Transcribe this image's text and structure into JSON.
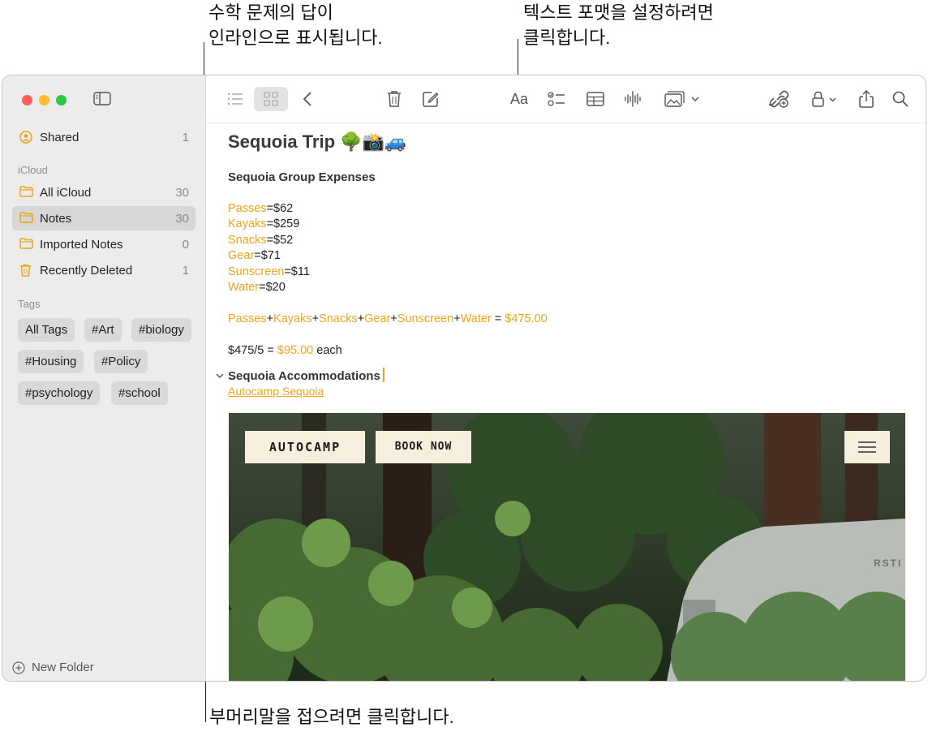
{
  "callouts": {
    "top_left_line1": "수학 문제의 답이",
    "top_left_line2": "인라인으로 표시됩니다.",
    "top_right_line1": "텍스트 포맷을 설정하려면",
    "top_right_line2": "클릭합니다.",
    "bottom": "부머리말을 접으려면 클릭합니다."
  },
  "sidebar": {
    "shared": {
      "label": "Shared",
      "count": "1"
    },
    "icloud_header": "iCloud",
    "folders": [
      {
        "label": "All iCloud",
        "count": "30"
      },
      {
        "label": "Notes",
        "count": "30"
      },
      {
        "label": "Imported Notes",
        "count": "0"
      },
      {
        "label": "Recently Deleted",
        "count": "1"
      }
    ],
    "tags_header": "Tags",
    "tags": [
      "All Tags",
      "#Art",
      "#biology",
      "#Housing",
      "#Policy",
      "#psychology",
      "#school"
    ],
    "new_folder": "New Folder"
  },
  "toolbar": {
    "format_label": "Aa"
  },
  "note": {
    "title": "Sequoia Trip 🌳📸🚙",
    "heading": "Sequoia Group Expenses",
    "expenses": [
      {
        "name": "Passes",
        "value": "=$62"
      },
      {
        "name": "Kayaks",
        "value": "=$259"
      },
      {
        "name": "Snacks",
        "value": "=$52"
      },
      {
        "name": "Gear",
        "value": "=$71"
      },
      {
        "name": "Sunscreen",
        "value": "=$11"
      },
      {
        "name": "Water",
        "value": "=$20"
      }
    ],
    "sum_formula_parts": [
      "Passes",
      "+",
      "Kayaks",
      "+",
      "Snacks",
      "+",
      "Gear",
      "+",
      "Sunscreen",
      "+",
      "Water",
      " = "
    ],
    "sum_result": "$475.00",
    "division": "$475/5 = ",
    "division_result": "$95.00",
    "division_suffix": " each",
    "subheading": "Sequoia Accommodations",
    "link": "Autocamp Sequoia",
    "embed": {
      "logo": "AUTOCAMP",
      "book_now": "BOOK NOW",
      "trailer_text": "RSTI"
    }
  }
}
